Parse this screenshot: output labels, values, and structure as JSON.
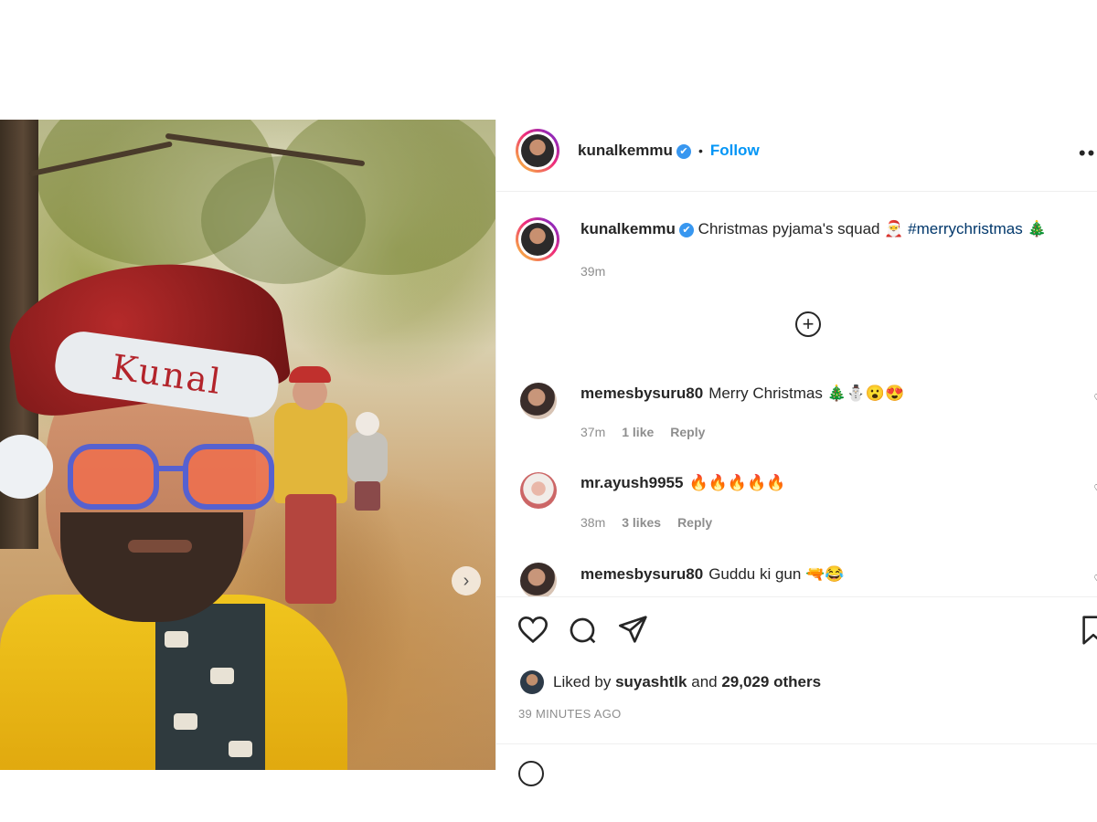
{
  "photo": {
    "hat_text": "Kunal"
  },
  "header": {
    "username": "kunalkemmu",
    "verified": "✔",
    "separator": "•",
    "follow_label": "Follow",
    "more_icon": "•••"
  },
  "caption": {
    "username": "kunalkemmu",
    "text": "Christmas pyjama's squad 🎅",
    "hashtag": "#merrychristmas",
    "emoji": "🎄",
    "time": "39m"
  },
  "comments": [
    {
      "username": "memesbysuru80",
      "text": "Merry Christmas 🎄⛄😮😍",
      "time": "37m",
      "likes": "1 like",
      "reply": "Reply"
    },
    {
      "username": "mr.ayush9955",
      "text": "🔥🔥🔥🔥🔥",
      "time": "38m",
      "likes": "3 likes",
      "reply": "Reply"
    },
    {
      "username": "memesbysuru80",
      "text": "Guddu ki gun 🔫😂"
    }
  ],
  "likes": {
    "prefix": "Liked by",
    "user": "suyashtlk",
    "middle": "and",
    "others": "29,029 others"
  },
  "timestamp": "39 MINUTES AGO",
  "icons": {
    "like": "heart-icon",
    "comment": "comment-icon",
    "share": "share-icon",
    "save": "bookmark-icon",
    "load_more": "plus-circle-icon",
    "next": "chevron-right-icon"
  },
  "colors": {
    "link": "#0095f6",
    "hashtag": "#00376b",
    "verified": "#3897f0",
    "muted": "#8e8e8e"
  }
}
